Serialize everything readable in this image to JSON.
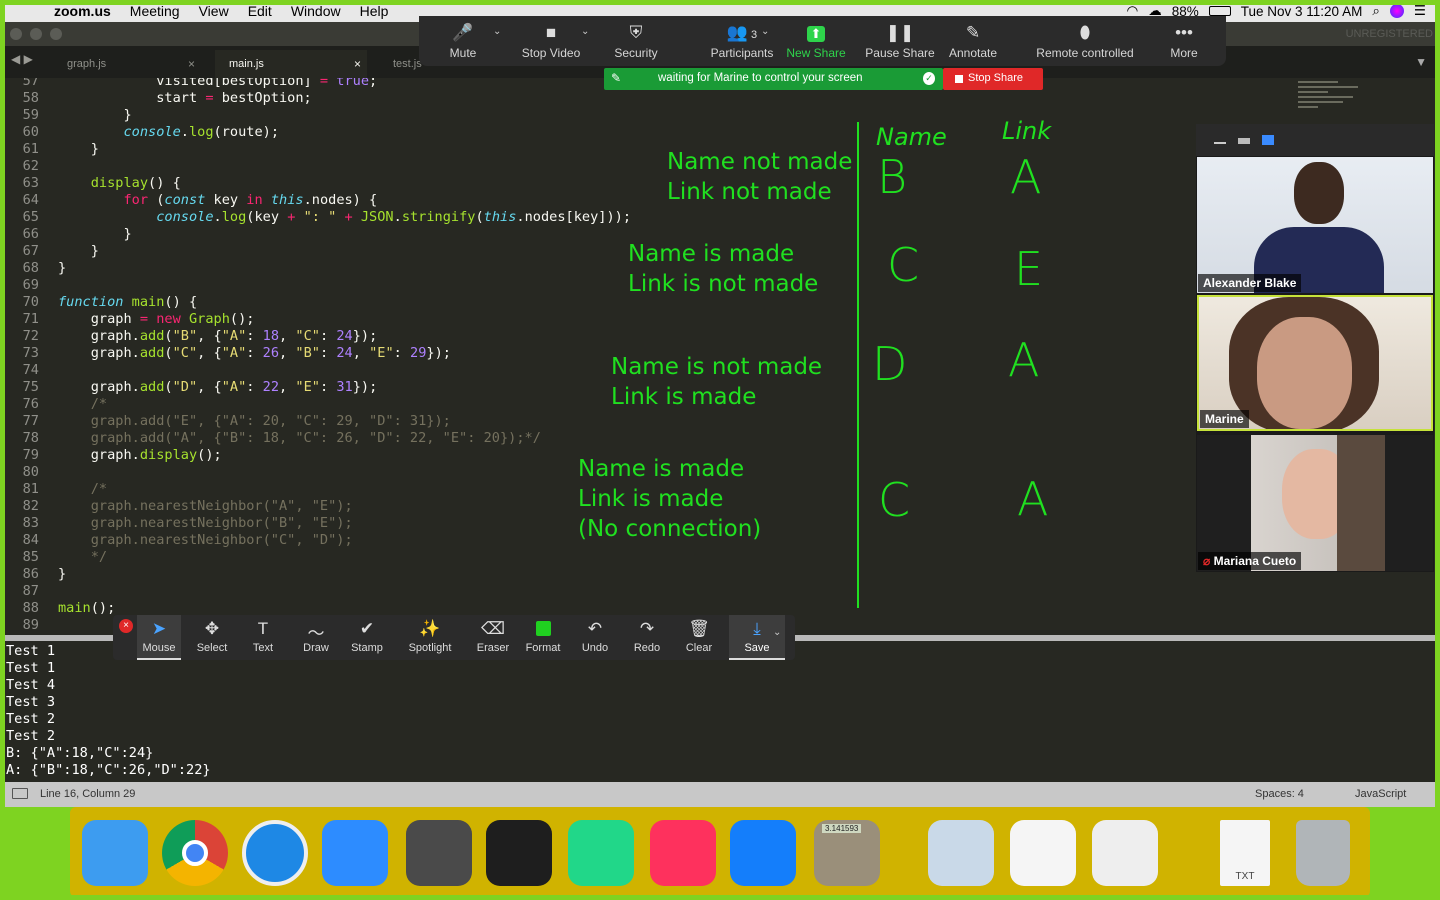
{
  "menubar": {
    "apple": "",
    "app": "zoom.us",
    "items": [
      "Meeting",
      "View",
      "Edit",
      "Window",
      "Help"
    ],
    "battery": "88%",
    "datetime": "Tue Nov 3  11:20 AM"
  },
  "editor": {
    "tabs": [
      {
        "label": "graph.js",
        "active": false
      },
      {
        "label": "main.js",
        "active": true
      },
      {
        "label": "test.js",
        "active": false
      }
    ],
    "unregistered": "UNREGISTERED",
    "status": {
      "position": "Line 16, Column 29",
      "spaces": "Spaces: 4",
      "language": "JavaScript"
    },
    "code_lines": [
      {
        "n": "57",
        "html": "            visited[bestOption] <span class=\"k\">=</span> <span class=\"n\">true</span>;"
      },
      {
        "n": "58",
        "html": "            start <span class=\"k\">=</span> bestOption;"
      },
      {
        "n": "59",
        "html": "        }"
      },
      {
        "n": "60",
        "html": "        <span class=\"t\">console</span>.<span class=\"f\">log</span>(route);"
      },
      {
        "n": "61",
        "html": "    }"
      },
      {
        "n": "62",
        "html": ""
      },
      {
        "n": "63",
        "html": "    <span class=\"f\">display</span>() {"
      },
      {
        "n": "64",
        "html": "        <span class=\"k\">for</span> (<span class=\"t\">const</span> key <span class=\"k\">in</span> <span class=\"t\">this</span>.nodes) {"
      },
      {
        "n": "65",
        "html": "            <span class=\"t\">console</span>.<span class=\"f\">log</span>(key <span class=\"k\">+</span> <span class=\"s\">\": \"</span> <span class=\"k\">+</span> <span class=\"f\">JSON</span>.<span class=\"f\">stringify</span>(<span class=\"t\">this</span>.nodes[key]));"
      },
      {
        "n": "66",
        "html": "        }"
      },
      {
        "n": "67",
        "html": "    }"
      },
      {
        "n": "68",
        "html": "}"
      },
      {
        "n": "69",
        "html": ""
      },
      {
        "n": "70",
        "html": "<span class=\"t\">function</span> <span class=\"f\">main</span>() {"
      },
      {
        "n": "71",
        "html": "    graph <span class=\"k\">=</span> <span class=\"k\">new</span> <span class=\"f\">Graph</span>();"
      },
      {
        "n": "72",
        "html": "    graph.<span class=\"f\">add</span>(<span class=\"s\">\"B\"</span>, {<span class=\"s\">\"A\"</span>: <span class=\"n\">18</span>, <span class=\"s\">\"C\"</span>: <span class=\"n\">24</span>});"
      },
      {
        "n": "73",
        "html": "    graph.<span class=\"f\">add</span>(<span class=\"s\">\"C\"</span>, {<span class=\"s\">\"A\"</span>: <span class=\"n\">26</span>, <span class=\"s\">\"B\"</span>: <span class=\"n\">24</span>, <span class=\"s\">\"E\"</span>: <span class=\"n\">29</span>});"
      },
      {
        "n": "74",
        "html": ""
      },
      {
        "n": "75",
        "html": "    graph.<span class=\"f\">add</span>(<span class=\"s\">\"D\"</span>, {<span class=\"s\">\"A\"</span>: <span class=\"n\">22</span>, <span class=\"s\">\"E\"</span>: <span class=\"n\">31</span>});"
      },
      {
        "n": "76",
        "html": "    <span class=\"c\">/*</span>"
      },
      {
        "n": "77",
        "html": "    <span class=\"c\">graph.add(\"E\", {\"A\": 20, \"C\": 29, \"D\": 31});</span>"
      },
      {
        "n": "78",
        "html": "    <span class=\"c\">graph.add(\"A\", {\"B\": 18, \"C\": 26, \"D\": 22, \"E\": 20});*/</span>"
      },
      {
        "n": "79",
        "html": "    graph.<span class=\"f\">display</span>();"
      },
      {
        "n": "80",
        "html": ""
      },
      {
        "n": "81",
        "html": "    <span class=\"c\">/*</span>"
      },
      {
        "n": "82",
        "html": "    <span class=\"c\">graph.nearestNeighbor(\"A\", \"E\");</span>"
      },
      {
        "n": "83",
        "html": "    <span class=\"c\">graph.nearestNeighbor(\"B\", \"E\");</span>"
      },
      {
        "n": "84",
        "html": "    <span class=\"c\">graph.nearestNeighbor(\"C\", \"D\");</span>"
      },
      {
        "n": "85",
        "html": "    <span class=\"c\">*/</span>"
      },
      {
        "n": "86",
        "html": "}"
      },
      {
        "n": "87",
        "html": ""
      },
      {
        "n": "88",
        "html": "<span class=\"f\">main</span>();"
      },
      {
        "n": "89",
        "html": ""
      }
    ],
    "console_lines": [
      "Test 1",
      "Test 1",
      "Test 4",
      "Test 3",
      "Test 2",
      "Test 2",
      "B: {\"A\":18,\"C\":24}",
      "A: {\"B\":18,\"C\":26,\"D\":22}"
    ]
  },
  "annotations": {
    "blocks": [
      "Name not made\nLink not made",
      "Name is made\nLink is not made",
      "Name is not made\nLink is made",
      "Name is made\nLink is made\n(No connection)"
    ],
    "headers": [
      "Name",
      "Link"
    ],
    "rows": [
      [
        "B",
        "A"
      ],
      [
        "C",
        "E"
      ],
      [
        "D",
        "A"
      ],
      [
        "C",
        "A"
      ]
    ],
    "color": "#20e020"
  },
  "zoom": {
    "toolbar": [
      {
        "label": "Mute",
        "icon": "microphone-icon",
        "glyph": "🎤"
      },
      {
        "label": "Stop Video",
        "icon": "video-camera-icon",
        "glyph": "■"
      },
      {
        "label": "Security",
        "icon": "shield-icon",
        "glyph": "⛨"
      },
      {
        "label": "Participants",
        "icon": "participants-icon",
        "glyph": "👥",
        "count": "3"
      },
      {
        "label": "New Share",
        "icon": "share-screen-icon",
        "glyph": "⬆"
      },
      {
        "label": "Pause Share",
        "icon": "pause-icon",
        "glyph": "❚❚"
      },
      {
        "label": "Annotate",
        "icon": "pencil-icon",
        "glyph": "✎"
      },
      {
        "label": "Remote controlled",
        "icon": "mouse-icon",
        "glyph": "⬮"
      },
      {
        "label": "More",
        "icon": "more-icon",
        "glyph": "•••"
      }
    ],
    "share_banner": "waiting for Marine to control your screen",
    "stop_share": "Stop Share",
    "participants": [
      {
        "name": "Alexander Blake"
      },
      {
        "name": "Marine",
        "active": true
      },
      {
        "name": "Mariana Cueto",
        "muted": true
      }
    ],
    "annotate_tools": [
      {
        "label": "Mouse",
        "icon": "mouse-pointer-icon",
        "glyph": "➤"
      },
      {
        "label": "Select",
        "icon": "select-move-icon",
        "glyph": "✥"
      },
      {
        "label": "Text",
        "icon": "text-icon",
        "glyph": "T"
      },
      {
        "label": "Draw",
        "icon": "draw-icon",
        "glyph": "〜"
      },
      {
        "label": "Stamp",
        "icon": "stamp-check-icon",
        "glyph": "✔"
      },
      {
        "label": "Spotlight",
        "icon": "spotlight-wand-icon",
        "glyph": "✨"
      },
      {
        "label": "Eraser",
        "icon": "eraser-icon",
        "glyph": "⌫"
      },
      {
        "label": "Format",
        "icon": "format-color-icon",
        "glyph": "■"
      },
      {
        "label": "Undo",
        "icon": "undo-icon",
        "glyph": "↶"
      },
      {
        "label": "Redo",
        "icon": "redo-icon",
        "glyph": "↷"
      },
      {
        "label": "Clear",
        "icon": "trash-icon",
        "glyph": "🗑"
      },
      {
        "label": "Save",
        "icon": "save-download-icon",
        "glyph": "⤓"
      }
    ],
    "accent_green": "#2ed44b",
    "stop_red": "#e02828"
  },
  "dock": {
    "apps": [
      {
        "name": "finder-icon",
        "color": "#3d9cf0"
      },
      {
        "name": "chrome-icon",
        "color": "#db4437"
      },
      {
        "name": "safari-icon",
        "color": "#1e88e5"
      },
      {
        "name": "zoom-app-icon",
        "color": "#2d8cff"
      },
      {
        "name": "sublime-text-icon",
        "color": "#4a4a4a"
      },
      {
        "name": "terminal-icon",
        "color": "#1e1e1e"
      },
      {
        "name": "pycharm-icon",
        "color": "#21d789"
      },
      {
        "name": "intellij-icon",
        "color": "#fe315d"
      },
      {
        "name": "xcode-icon",
        "color": "#147efb"
      },
      {
        "name": "calculator-icon",
        "color": "#9a8f7a"
      },
      {
        "name": "preview-icon",
        "color": "#c9d9e8"
      },
      {
        "name": "reminders-icon",
        "color": "#f5f5f5"
      },
      {
        "name": "textedit-icon",
        "color": "#eeeeee"
      },
      {
        "name": "txt-file-icon",
        "color": "#f5f5f5"
      },
      {
        "name": "trash-icon",
        "color": "#b0b5b8"
      }
    ],
    "calculator_display": "3.141593",
    "txt_label": "TXT"
  }
}
